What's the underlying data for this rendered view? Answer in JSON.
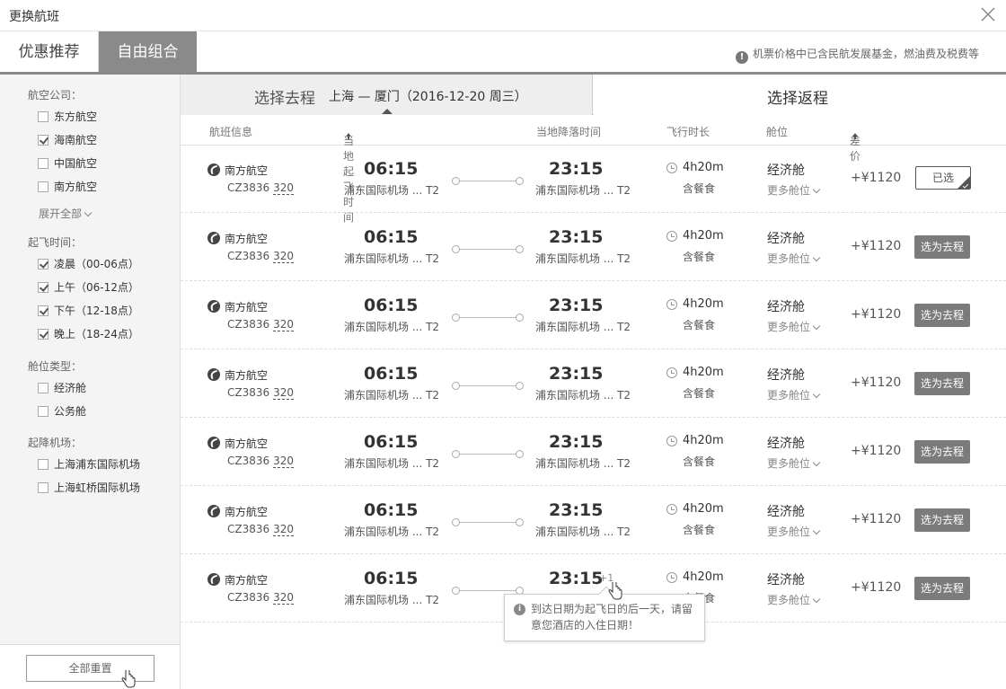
{
  "window": {
    "title": "更换航班"
  },
  "tabs": {
    "promo": "优惠推荐",
    "custom": "自由组合"
  },
  "notice": "机票价格中已含民航发展基金，燃油费及税费等",
  "sidebar": {
    "airline_head": "航空公司：",
    "airlines": [
      {
        "label": "东方航空",
        "checked": false
      },
      {
        "label": "海南航空",
        "checked": true
      },
      {
        "label": "中国航空",
        "checked": false
      },
      {
        "label": "南方航空",
        "checked": false
      }
    ],
    "expand_all": "展开全部",
    "time_head": "起飞时间：",
    "times": [
      {
        "label": "凌晨（00-06点）",
        "checked": true
      },
      {
        "label": "上午（06-12点）",
        "checked": true
      },
      {
        "label": "下午（12-18点）",
        "checked": true
      },
      {
        "label": "晚上（18-24点）",
        "checked": true
      }
    ],
    "cabin_head": "舱位类型：",
    "cabins": [
      {
        "label": "经济舱",
        "checked": false
      },
      {
        "label": "公务舱",
        "checked": false
      }
    ],
    "airport_head": "起降机场：",
    "airports": [
      {
        "label": "上海浦东国际机场",
        "checked": false
      },
      {
        "label": "上海虹桥国际机场",
        "checked": false
      }
    ],
    "reset": "全部重置"
  },
  "direction": {
    "go_label": "选择去程",
    "go_route": "上海 — 厦门（2016-12-20 周三）",
    "back_label": "选择返程"
  },
  "headers": {
    "info": "航班信息",
    "dep": "当地起飞时间",
    "arr": "当地降落时间",
    "dur": "飞行时长",
    "cabin": "舱位",
    "price": "差价"
  },
  "flights": [
    {
      "airline": "南方航空",
      "no": "CZ3836",
      "plane": "320",
      "dep_time": "06:15",
      "dep_ap": "浦东国际机场 ... T2",
      "arr_time": "23:15",
      "arr_ap": "浦东国际机场 ... T2",
      "dur": "4h20m",
      "meal": "含餐食",
      "cabin": "经济舱",
      "more": "更多舱位",
      "price": "+¥1120",
      "btn": "已选",
      "selected": true
    },
    {
      "airline": "南方航空",
      "no": "CZ3836",
      "plane": "320",
      "dep_time": "06:15",
      "dep_ap": "浦东国际机场 ... T2",
      "arr_time": "23:15",
      "arr_ap": "浦东国际机场 ... T2",
      "dur": "4h20m",
      "meal": "含餐食",
      "cabin": "经济舱",
      "more": "更多舱位",
      "price": "+¥1120",
      "btn": "选为去程",
      "selected": false
    },
    {
      "airline": "南方航空",
      "no": "CZ3836",
      "plane": "320",
      "dep_time": "06:15",
      "dep_ap": "浦东国际机场 ... T2",
      "arr_time": "23:15",
      "arr_ap": "浦东国际机场 ... T2",
      "dur": "4h20m",
      "meal": "含餐食",
      "cabin": "经济舱",
      "more": "更多舱位",
      "price": "+¥1120",
      "btn": "选为去程",
      "selected": false
    },
    {
      "airline": "南方航空",
      "no": "CZ3836",
      "plane": "320",
      "dep_time": "06:15",
      "dep_ap": "浦东国际机场 ... T2",
      "arr_time": "23:15",
      "arr_ap": "浦东国际机场 ... T2",
      "dur": "4h20m",
      "meal": "含餐食",
      "cabin": "经济舱",
      "more": "更多舱位",
      "price": "+¥1120",
      "btn": "选为去程",
      "selected": false
    },
    {
      "airline": "南方航空",
      "no": "CZ3836",
      "plane": "320",
      "dep_time": "06:15",
      "dep_ap": "浦东国际机场 ... T2",
      "arr_time": "23:15",
      "arr_ap": "浦东国际机场 ... T2",
      "dur": "4h20m",
      "meal": "含餐食",
      "cabin": "经济舱",
      "more": "更多舱位",
      "price": "+¥1120",
      "btn": "选为去程",
      "selected": false
    },
    {
      "airline": "南方航空",
      "no": "CZ3836",
      "plane": "320",
      "dep_time": "06:15",
      "dep_ap": "浦东国际机场 ... T2",
      "arr_time": "23:15",
      "arr_ap": "浦东国际机场 ... T2",
      "dur": "4h20m",
      "meal": "含餐食",
      "cabin": "经济舱",
      "more": "更多舱位",
      "price": "+¥1120",
      "btn": "选为去程",
      "selected": false
    },
    {
      "airline": "南方航空",
      "no": "CZ3836",
      "plane": "320",
      "dep_time": "06:15",
      "dep_ap": "浦东国际机场 ... T2",
      "arr_time": "23:15",
      "arr_ap": "浦东国际机场 ... T2",
      "dur": "4h20m",
      "meal": "含餐食",
      "cabin": "经济舱",
      "more": "更多舱位",
      "price": "+¥1120",
      "btn": "选为去程",
      "selected": false,
      "plus_day": "+1"
    }
  ],
  "tooltip": "到达日期为起飞日的后一天，请留意您酒店的入住日期！"
}
